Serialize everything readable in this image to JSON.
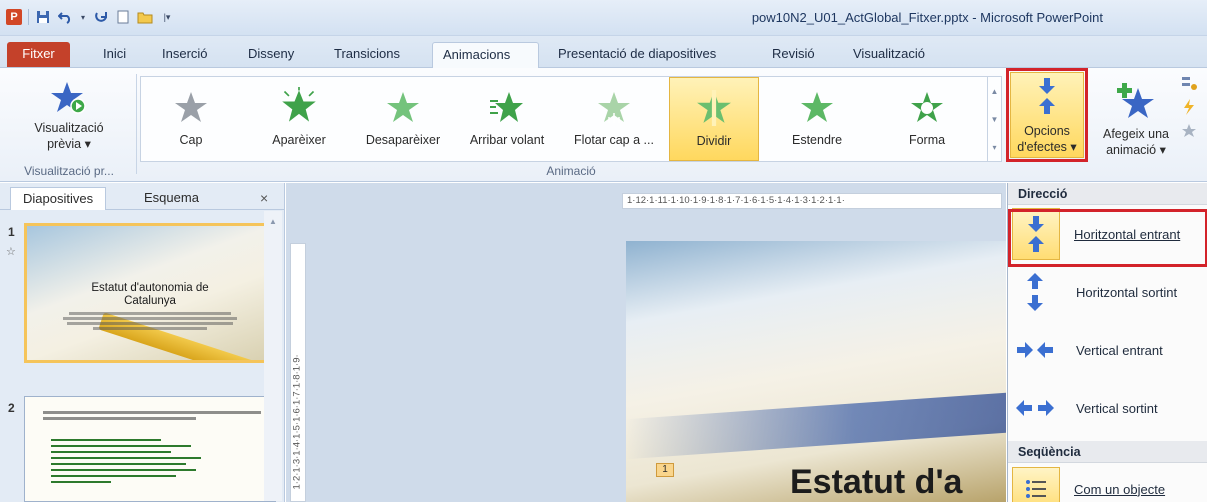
{
  "window": {
    "title": "pow10N2_U01_ActGlobal_Fitxer.pptx - Microsoft PowerPoint"
  },
  "tabs": [
    "Fitxer",
    "Inici",
    "Inserció",
    "Disseny",
    "Transicions",
    "Animacions",
    "Presentació de diapositives",
    "Revisió",
    "Visualització"
  ],
  "ribbon": {
    "preview": {
      "label1": "Visualització",
      "label2": "prèvia ▾",
      "group": "Visualització pr..."
    },
    "animations": [
      "Cap",
      "Aparèixer",
      "Desaparèixer",
      "Arribar volant",
      "Flotar cap a ...",
      "Dividir",
      "Estendre",
      "Forma"
    ],
    "selected_animation": "Dividir",
    "animation_group": "Animació",
    "effect_options": {
      "label1": "Opcions",
      "label2": "d'efectes ▾"
    },
    "add_animation": {
      "label1": "Afegeix una",
      "label2": "animació ▾"
    }
  },
  "left_pane": {
    "tab_slides": "Diapositives",
    "tab_outline": "Esquema",
    "close": "×",
    "slide1": {
      "number": "1",
      "title_line1": "Estatut d'autonomia de",
      "title_line2": "Catalunya"
    },
    "slide2": {
      "number": "2"
    }
  },
  "editor": {
    "ruler": "1·12·1·11·1·10·1·9·1·8·1·7·1·6·1·5·1·4·1·3·1·2·1·1·",
    "vruler": "1·2·1·3·1·4·1·5·1·6·1·7·1·8·1·9·",
    "slide_title": "Estatut d'a",
    "anim_tag": "1"
  },
  "menu": {
    "direction_header": "Direcció",
    "items": [
      {
        "label": "Horitzontal entrant",
        "accel": ""
      },
      {
        "label": "Horitzontal sortint"
      },
      {
        "label": "Vertical entrant"
      },
      {
        "label": "Vertical sortint"
      }
    ],
    "sequence_header": "Seqüència",
    "sequence_item": "Com un objecte"
  }
}
